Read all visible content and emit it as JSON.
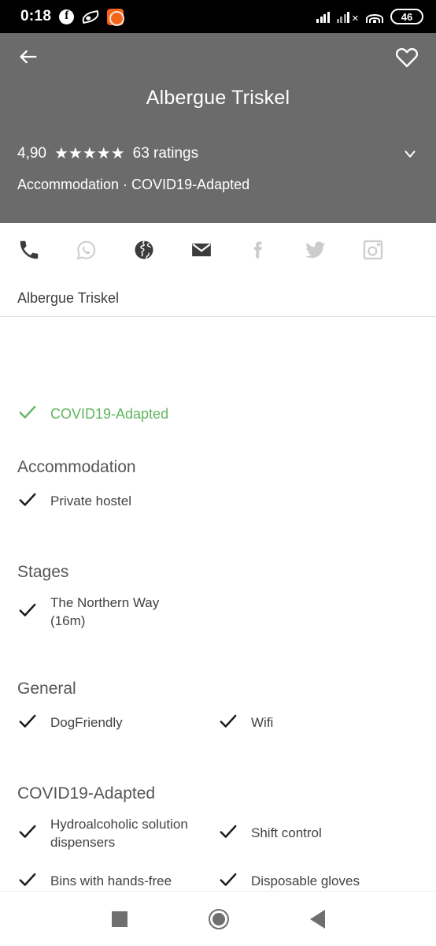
{
  "status_bar": {
    "time": "0:18",
    "battery_level": "46",
    "icons": [
      "facebook-icon",
      "leaf-icon",
      "orange-app-icon",
      "signal-icon",
      "signal-no-service-icon",
      "wifi-icon",
      "battery-icon"
    ]
  },
  "header": {
    "background_color": "#6b6b6b",
    "back_icon": "back-arrow-icon",
    "favorite_icon": "heart-outline-icon",
    "title": "Albergue Triskel",
    "rating_score": "4,90",
    "stars": "★★★★★",
    "star_count": 5,
    "rating_count": "63 ratings",
    "expand_icon": "chevron-down-icon",
    "subtitle": "Accommodation · COVID19-Adapted"
  },
  "contact": {
    "icons": [
      {
        "name": "phone-icon",
        "enabled": true
      },
      {
        "name": "whatsapp-icon",
        "enabled": false
      },
      {
        "name": "website-globe-icon",
        "enabled": true
      },
      {
        "name": "email-icon",
        "enabled": true
      },
      {
        "name": "facebook-icon",
        "enabled": false
      },
      {
        "name": "twitter-icon",
        "enabled": false
      },
      {
        "name": "instagram-icon",
        "enabled": false
      }
    ],
    "name": "Albergue Triskel"
  },
  "badge": {
    "check_icon": "check-icon",
    "label": "COVID19-Adapted",
    "color": "#61b561"
  },
  "sections": [
    {
      "title": "Accommodation",
      "items": [
        {
          "label": "Private hostel",
          "full_width": true
        }
      ]
    },
    {
      "title": "Stages",
      "items": [
        {
          "label": "The Northern Way (16m)",
          "full_width": true
        }
      ]
    },
    {
      "title": "General",
      "items": [
        {
          "label": "DogFriendly",
          "full_width": false
        },
        {
          "label": "Wifi",
          "full_width": false
        }
      ]
    },
    {
      "title": "COVID19-Adapted",
      "items": [
        {
          "label": "Hydroalcoholic solution dispensers",
          "full_width": false
        },
        {
          "label": "Shift control",
          "full_width": false
        },
        {
          "label": "Bins with hands-free",
          "full_width": false
        },
        {
          "label": "Disposable gloves",
          "full_width": false
        }
      ]
    }
  ],
  "nav_bar": {
    "recents": "recents-square-icon",
    "home": "home-circle-icon",
    "back": "back-triangle-icon"
  }
}
